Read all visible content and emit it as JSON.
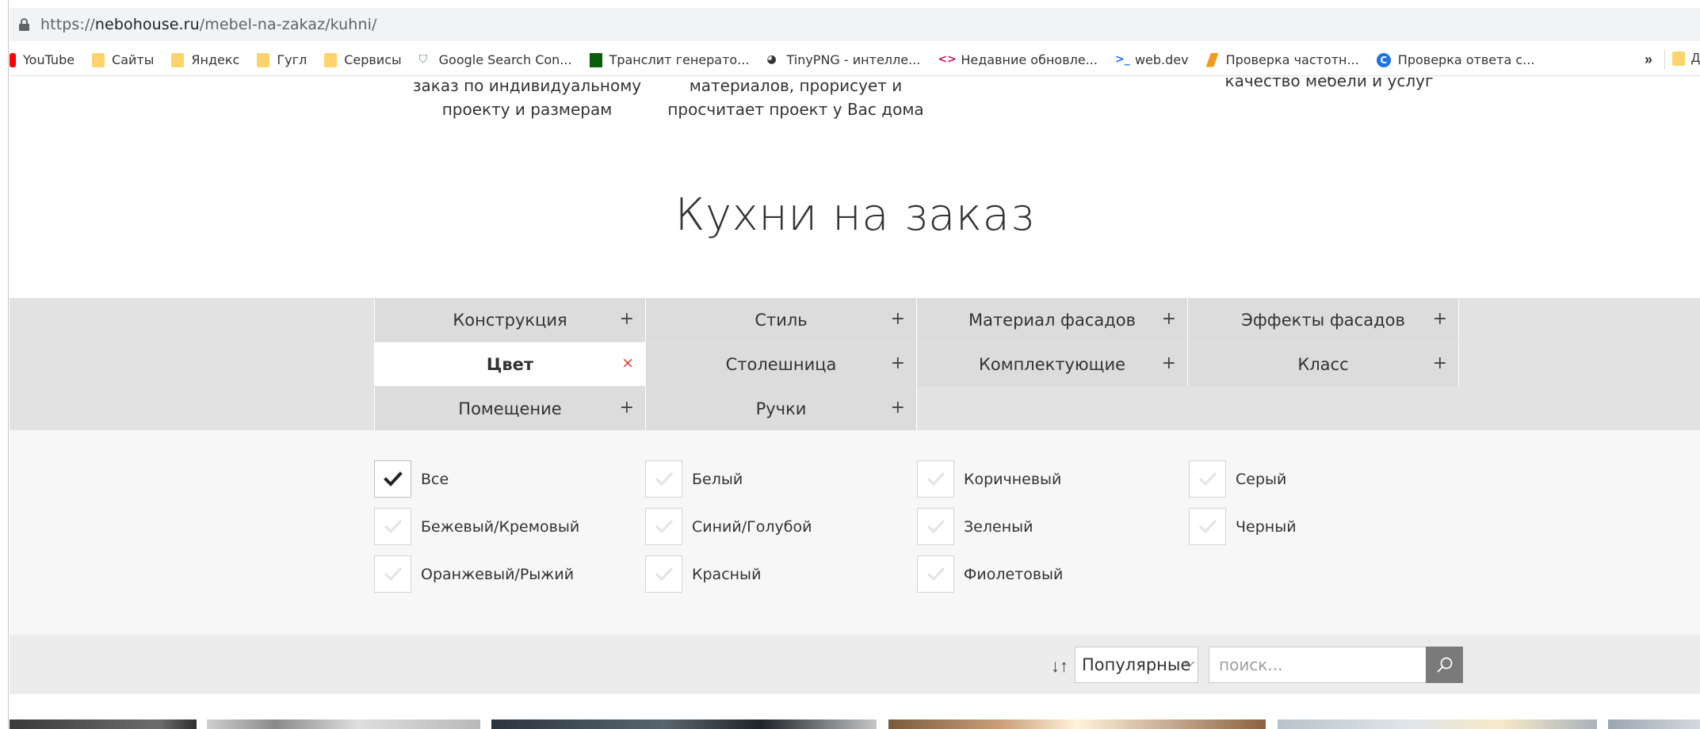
{
  "browser": {
    "url_scheme": "https://",
    "url_host": "nebohouse.ru",
    "url_path": "/mebel-na-zakaz/kuhni/",
    "bookmarks": [
      {
        "label": "YouTube",
        "icon": "youtube-icon"
      },
      {
        "label": "Сайты",
        "icon": "folder-icon"
      },
      {
        "label": "Яндекс",
        "icon": "folder-icon"
      },
      {
        "label": "Гугл",
        "icon": "folder-icon"
      },
      {
        "label": "Сервисы",
        "icon": "folder-icon"
      },
      {
        "label": "Google Search Con...",
        "icon": "search-console-icon"
      },
      {
        "label": "Транслит генерато...",
        "icon": "green-square-icon"
      },
      {
        "label": "TinyPNG - интелле...",
        "icon": "panda-icon"
      },
      {
        "label": "Недавние обновле...",
        "icon": "code-icon"
      },
      {
        "label": "web.dev",
        "icon": "webdev-icon"
      },
      {
        "label": "Проверка частотн...",
        "icon": "orange-icon"
      },
      {
        "label": "Проверка ответа с...",
        "icon": "g-circle-icon"
      }
    ],
    "more_label": "»",
    "last_bookmark": "Д"
  },
  "features": {
    "f1_line1": "заказ по индивидуальному",
    "f1_line2": "проекту и размерам",
    "f2_line1": "материалов, прорисует и",
    "f2_line2": "просчитает проект у Вас дома",
    "f3_line1": "качество мебели и услуг"
  },
  "page_title": "Кухни на заказ",
  "filters": {
    "row1": [
      {
        "label": "Конструкция",
        "sign": "+"
      },
      {
        "label": "Стиль",
        "sign": "+"
      },
      {
        "label": "Материал фасадов",
        "sign": "+"
      },
      {
        "label": "Эффекты фасадов",
        "sign": "+"
      }
    ],
    "row2": [
      {
        "label": "Цвет",
        "sign": "×"
      },
      {
        "label": "Столешница",
        "sign": "+"
      },
      {
        "label": "Комплектующие",
        "sign": "+"
      },
      {
        "label": "Класс",
        "sign": "+"
      }
    ],
    "row3": [
      {
        "label": "Помещение",
        "sign": "+"
      },
      {
        "label": "Ручки",
        "sign": "+"
      }
    ],
    "active": "Цвет"
  },
  "color_options": [
    {
      "label": "Все",
      "checked": true
    },
    {
      "label": "Белый",
      "checked": false
    },
    {
      "label": "Коричневый",
      "checked": false
    },
    {
      "label": "Серый",
      "checked": false
    },
    {
      "label": "Бежевый/Кремовый",
      "checked": false
    },
    {
      "label": "Синий/Голубой",
      "checked": false
    },
    {
      "label": "Зеленый",
      "checked": false
    },
    {
      "label": "Черный",
      "checked": false
    },
    {
      "label": "Оранжевый/Рыжий",
      "checked": false
    },
    {
      "label": "Красный",
      "checked": false
    },
    {
      "label": "Фиолетовый",
      "checked": false
    }
  ],
  "sort": {
    "icon": "↓↑",
    "selected": "Популярные",
    "search_placeholder": "поиск..."
  },
  "colors": {
    "accent_close": "#e53935",
    "filter_bg": "#dcdcdc",
    "search_button": "#7a7a7a"
  }
}
